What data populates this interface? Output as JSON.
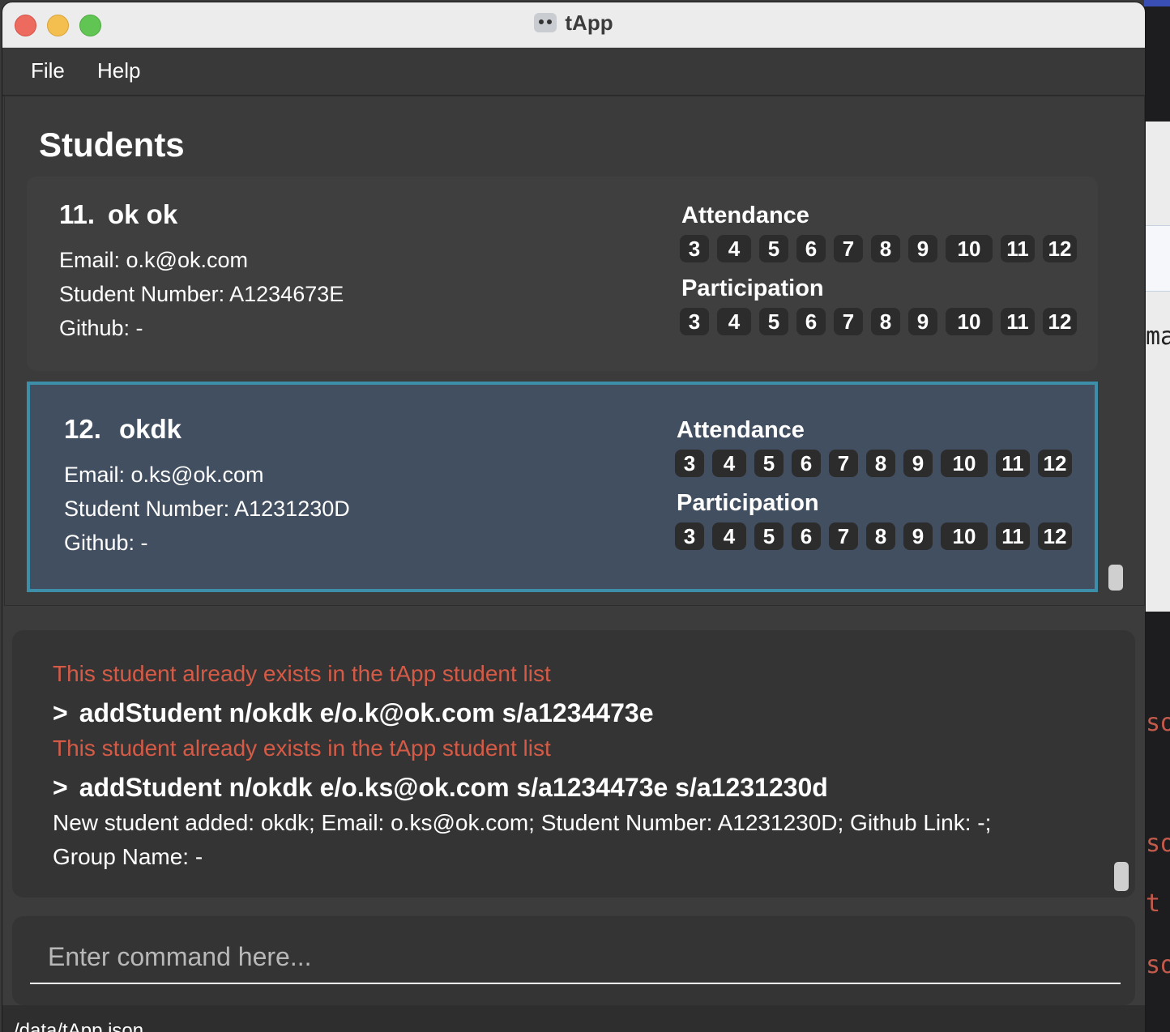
{
  "window": {
    "title": "tApp"
  },
  "menu": {
    "file": "File",
    "help": "Help"
  },
  "students_title": "Students",
  "students": [
    {
      "index": "11.",
      "name": "ok ok",
      "email": "Email: o.k@ok.com",
      "student_number": "Student Number: A1234673E",
      "github": "Github: -",
      "attendance_label": "Attendance",
      "attendance": [
        "3",
        "4",
        "5",
        "6",
        "7",
        "8",
        "9",
        "10",
        "11",
        "12"
      ],
      "participation_label": "Participation",
      "participation": [
        "3",
        "4",
        "5",
        "6",
        "7",
        "8",
        "9",
        "10",
        "11",
        "12"
      ],
      "selected": false
    },
    {
      "index": "12.",
      "name": "okdk",
      "email": "Email: o.ks@ok.com",
      "student_number": "Student Number: A1231230D",
      "github": "Github: -",
      "attendance_label": "Attendance",
      "attendance": [
        "3",
        "4",
        "5",
        "6",
        "7",
        "8",
        "9",
        "10",
        "11",
        "12"
      ],
      "participation_label": "Participation",
      "participation": [
        "3",
        "4",
        "5",
        "6",
        "7",
        "8",
        "9",
        "10",
        "11",
        "12"
      ],
      "selected": true
    }
  ],
  "result": {
    "lines": [
      {
        "type": "err",
        "text": "This student already exists in the tApp student list"
      },
      {
        "type": "cmd",
        "prompt": ">",
        "text": "addStudent n/okdk e/o.k@ok.com s/a1234473e"
      },
      {
        "type": "err",
        "text": "This student already exists in the tApp student list"
      },
      {
        "type": "cmd",
        "prompt": ">",
        "text": "addStudent n/okdk e/o.ks@ok.com s/a1234473e s/a1231230d"
      },
      {
        "type": "info",
        "text": "New student added: okdk; Email: o.ks@ok.com; Student Number: A1231230D; Github Link: -;"
      },
      {
        "type": "info",
        "text": "Group Name: -"
      }
    ]
  },
  "command": {
    "placeholder": "Enter command here...",
    "value": ""
  },
  "status": {
    "path": "/data/tApp.json"
  },
  "background_fragments": [
    "ma",
    "sor",
    "sor",
    "t",
    "sor"
  ],
  "colors": {
    "selected_border": "#3d8ea8",
    "selected_bg": "#424f60",
    "error_text": "#d55b47"
  }
}
